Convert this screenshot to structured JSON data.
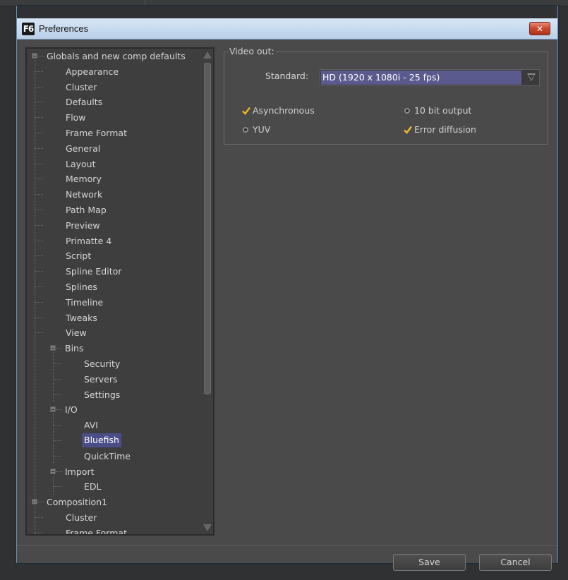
{
  "window": {
    "app_icon_text": "F6",
    "title": "Preferences",
    "close_glyph": "✕"
  },
  "tree": [
    {
      "label": "Globals and new comp defaults",
      "depth": 0,
      "expander": true
    },
    {
      "label": "Appearance",
      "depth": 1
    },
    {
      "label": "Cluster",
      "depth": 1
    },
    {
      "label": "Defaults",
      "depth": 1
    },
    {
      "label": "Flow",
      "depth": 1
    },
    {
      "label": "Frame Format",
      "depth": 1
    },
    {
      "label": "General",
      "depth": 1
    },
    {
      "label": "Layout",
      "depth": 1
    },
    {
      "label": "Memory",
      "depth": 1
    },
    {
      "label": "Network",
      "depth": 1
    },
    {
      "label": "Path Map",
      "depth": 1
    },
    {
      "label": "Preview",
      "depth": 1
    },
    {
      "label": "Primatte 4",
      "depth": 1
    },
    {
      "label": "Script",
      "depth": 1
    },
    {
      "label": "Spline Editor",
      "depth": 1
    },
    {
      "label": "Splines",
      "depth": 1
    },
    {
      "label": "Timeline",
      "depth": 1
    },
    {
      "label": "Tweaks",
      "depth": 1
    },
    {
      "label": "View",
      "depth": 1
    },
    {
      "label": "Bins",
      "depth": 1,
      "expander": true
    },
    {
      "label": "Security",
      "depth": 2
    },
    {
      "label": "Servers",
      "depth": 2
    },
    {
      "label": "Settings",
      "depth": 2
    },
    {
      "label": "I/O",
      "depth": 1,
      "expander": true
    },
    {
      "label": "AVI",
      "depth": 2
    },
    {
      "label": "Bluefish",
      "depth": 2,
      "selected": true
    },
    {
      "label": "QuickTime",
      "depth": 2
    },
    {
      "label": "Import",
      "depth": 1,
      "expander": true
    },
    {
      "label": "EDL",
      "depth": 2
    },
    {
      "label": "Composition1",
      "depth": 0,
      "expander": true
    },
    {
      "label": "Cluster",
      "depth": 1
    },
    {
      "label": "Frame Format",
      "depth": 1
    }
  ],
  "video_out": {
    "group_title": "Video out:",
    "standard_label": "Standard:",
    "standard_value": "HD  (1920 x 1080i - 25   fps)",
    "options": {
      "asynchronous": {
        "label": "Asynchronous",
        "type": "check",
        "checked": true
      },
      "ten_bit": {
        "label": "10 bit output",
        "type": "radio",
        "checked": false
      },
      "yuv": {
        "label": "YUV",
        "type": "radio",
        "checked": false
      },
      "error_diffusion": {
        "label": "Error diffusion",
        "type": "check",
        "checked": true
      }
    }
  },
  "buttons": {
    "save": "Save",
    "cancel": "Cancel"
  },
  "colors": {
    "selection": "#4a4d86",
    "check": "#e8b428",
    "close_button": "#c8462c"
  }
}
